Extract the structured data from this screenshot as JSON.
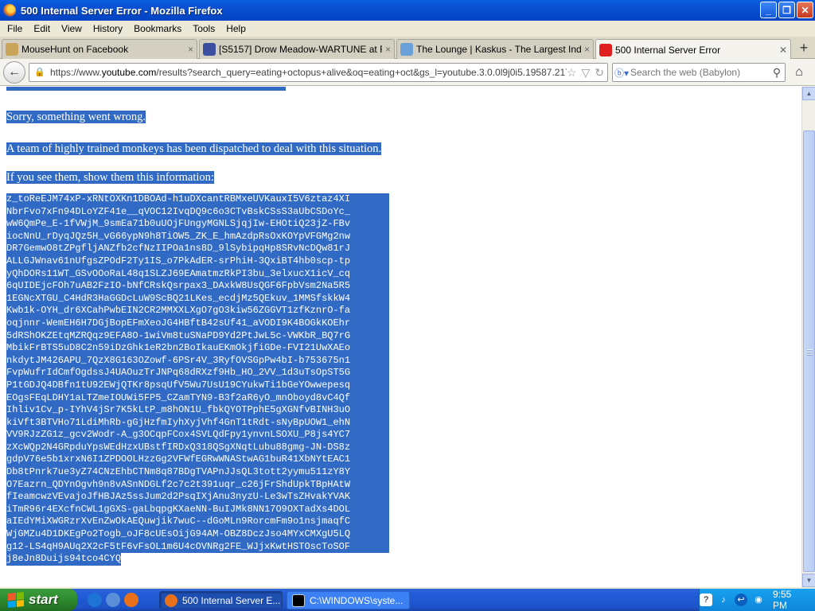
{
  "window": {
    "title": "500 Internal Server Error - Mozilla Firefox",
    "buttons": {
      "minimize": "_",
      "maximize": "❐",
      "close": "✕"
    }
  },
  "menu": [
    "File",
    "Edit",
    "View",
    "History",
    "Bookmarks",
    "Tools",
    "Help"
  ],
  "tabs": [
    {
      "label": "MouseHunt on Facebook",
      "icon_color": "#c9a45a",
      "close": "×",
      "active": false
    },
    {
      "label": "[S5157] Drow Meadow-WARTUNE at R2G...",
      "icon_color": "#3a4fa0",
      "close": "×",
      "active": false
    },
    {
      "label": "The Lounge | Kaskus - The Largest Indon...",
      "icon_color": "#6aa0d8",
      "close": "×",
      "active": false
    },
    {
      "label": "500 Internal Server Error",
      "icon_color": "#e02020",
      "close": "✕",
      "active": true
    }
  ],
  "newtab": "+",
  "nav": {
    "back_icon": "←",
    "url_prefix": "https://www.",
    "url_host": "youtube.com",
    "url_rest": "/results?search_query=eating+octopus+alive&oq=eating+oct&gs_l=youtube.3.0.0l9j0i5.19587.21757.0.2",
    "url_icons": [
      "☆",
      "▽",
      "↻"
    ],
    "search_engine": "Babylon",
    "search_placeholder": "Search the web (Babylon)",
    "search_icon": "⚲",
    "home_icon": "⌂"
  },
  "content": {
    "messages": [
      "Sorry, something went wrong.",
      "A team of highly trained monkeys has been dispatched to deal with this situation.",
      "If you see them, show them this information:"
    ],
    "code_lines": [
      "z_toReEJM74xP-xRNtOXKn1DBOAd-h1uDXcantRBMxeUVKauxI5V6ztaz4XI",
      "NbrFvo7xFn94DLoYZF41e__qVOC12IvqDQ9c6o3CTvBskCSsS3aUbCSDoYc_",
      "wW6QmPe_E-1fVWjM_9smEa71b0uUOjFUngyMGNLSjqjIw-EHOtiQ23jZ-FBv",
      "iocNnU_rDyqJQz5H_vG66ypN9h8TiOW5_ZK_E_hmAzdpRsOxKOYpVFGMg2nw",
      "DR7GemwO8tZPgfljANZfb2cfNzIIPOa1ns8D_9lSybipqHp8SRvNcDQw81rJ",
      "ALLGJWnav61nUfgsZPOdF2Ty1IS_o7PkAdER-srPhiH-3QxiBT4hb0scp-tp",
      "yQhDORs11WT_GSvOOoRaL48q1SLZJ69EAmatmzRkPI3bu_3elxucX1icV_cq",
      "6qUIDEjcFOh7uAB2FzIO-bNfCRskQsrpax3_DAxkW8UsQGF6FpbVsm2Na5R5",
      "1EGNcXTGU_C4HdR3HaGGDcLuW9ScBQ21LKes_ecdjMz5QEkuv_1MMSfskkW4",
      "Kwb1k-OYH_dr6XCahPwbEIN2CR2MMXXLXgO7gO3kiw56ZGGVT1zfKznrO-fa",
      "oqjnnr-WemEH6H7DGjBopEFmXeoJG4HBftB42sUf41_aVODI9K4BOGkKOEhr",
      "5dRShOKZEtqMZRQqz9EFA8O-1wiVm8tuSNaPD9Yd2PtJwL5c-VWKbR_BQ7rG",
      "MbikFrBTS5uD8C2n59iDzGhk1eR2bn2BoIkauEKmOkjfiGDe-FVI21UwXAEo",
      "nkdytJM426APU_7QzX8G163OZowf-6PSr4V_3RyfOVSGpPw4bI-b753675n1",
      "FvpWufrIdCmfOgdssJ4UAOuzTrJNPq68dRXzf9Hb_HO_2VV_1d3uTsOpST5G",
      "P1tGDJQ4DBfn1tU92EWjQTKr8psqUfV5Wu7UsU19CYukwTi1bGeYOwwepesq",
      "EOgsFEqLDHY1aLTZmeIOUWi5FP5_CZamTYN9-B3f2aR6yO_mnOboyd8vC4Qf",
      "Ihliv1Cv_p-IYhV4jSr7K5kLtP_m8hON1U_fbkQYOTPphE5gXGNfvBINH3uO",
      "kiVft3BTVHo71LdiMhRb-gGjHzfmIyhXyjVhf4GnT1tRdt-sNyBpUOW1_ehN",
      "VV9RJzZG1z_gcv2Wodr-A_g3OCqpFCox4SVLQdFpy1ynvnLSOXU_P8js4YC7",
      "zXcWQp2N4GRpduYpsWEdHzxUBstfIRDxQ318QSgXNqtLubu88gmg-JN-DS8z",
      "gdpV76e5b1xrxN6I1ZPDOOLHzzGg2VFWfEGRwWNAStwAG1buR41XbNYtEAC1",
      "Db8tPnrk7ue3yZ74CNzEhbCTNm8q87BDgTVAPnJJsQL3tott2yymu511zY8Y",
      "O7Eazrn_QDYnOgvh9n8vASnNDGLf2c7c2t391uqr_c26jFrShdUpkTBpHAtW",
      "fIeamcwzVEvajoJfHBJAz5ssJum2d2PsqIXjAnu3nyzU-Le3wTsZHvakYVAK",
      "iTmR96r4EXcfnCWL1gGXS-gaLbqpgKXaeNN-BuIJMk8NN17O9OXTadXs4DOL",
      "aIEdYMiXWGRzrXvEnZwOkAEQuwjik7wuC--dGoMLn9RorcmFm9o1nsjmaqfC",
      "WjGMZu4D1DKEgPo2Togb_oJF8cUEsOijG94AM-OBZ8DczJso4MYxCMXgU5LQ",
      "g12-LS4qH9AUq2X2cF5tF6vFsOL1m6U4cOVNRg2FE_WJjxKwtHSTOscToSOF",
      "j8eJn8Duijs94tco4CYQ"
    ]
  },
  "taskbar": {
    "start_label": "start",
    "quicklaunch": [
      {
        "name": "ie-icon",
        "color": "#1e74d6"
      },
      {
        "name": "browser-icon",
        "color": "#5a8fd8"
      },
      {
        "name": "firefox-icon",
        "color": "#e8711a"
      }
    ],
    "items": [
      {
        "label": "500 Internal Server E...",
        "icon_color": "#e8711a",
        "active": true
      },
      {
        "label": "C:\\WINDOWS\\syste...",
        "icon_color": "#000000",
        "active": false
      }
    ],
    "tray_icons": [
      "?",
      "♪",
      "↩",
      "◉"
    ],
    "clock": "9:55 PM"
  },
  "colors": {
    "selection": "#316ac5",
    "titlebar": "#0a4fd0",
    "start_green": "#2f8a2f",
    "tray_blue": "#0f86d9"
  }
}
